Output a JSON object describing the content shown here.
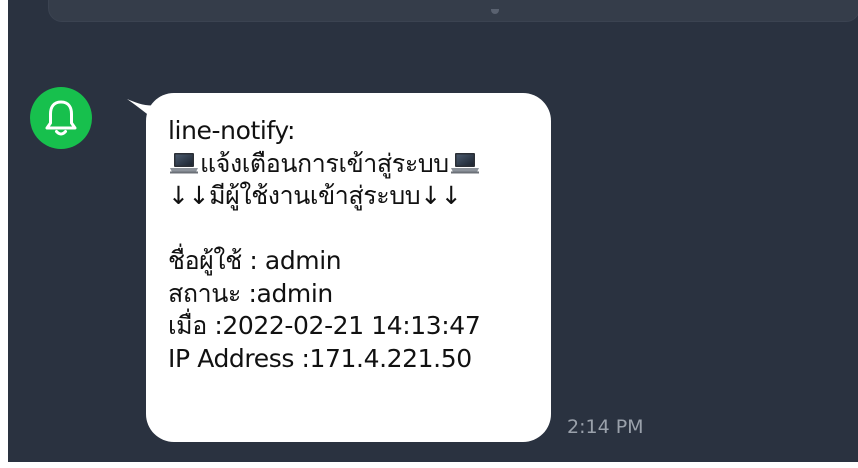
{
  "chat": {
    "sender_avatar_icon": "bell-icon",
    "message": {
      "sender_line": "line-notify:",
      "title_text": "แจ้งเตือนการเข้าสู่ระบบ",
      "title_icon": "laptop-icon",
      "subtitle": "↓↓มีผู้ใช้งานเข้าสู่ระบบ↓↓",
      "username_line": "ชื่อผู้ใช้ : admin",
      "status_line": "สถานะ :admin",
      "time_line": "เมื่อ :2022-02-21 14:13:47",
      "ip_line": "IP Address :171.4.221.50"
    },
    "timestamp": "2:14 PM"
  },
  "colors": {
    "background": "#2a3240",
    "bubble": "#ffffff",
    "avatar": "#17c04d",
    "timestamp": "#9aa1ab"
  }
}
